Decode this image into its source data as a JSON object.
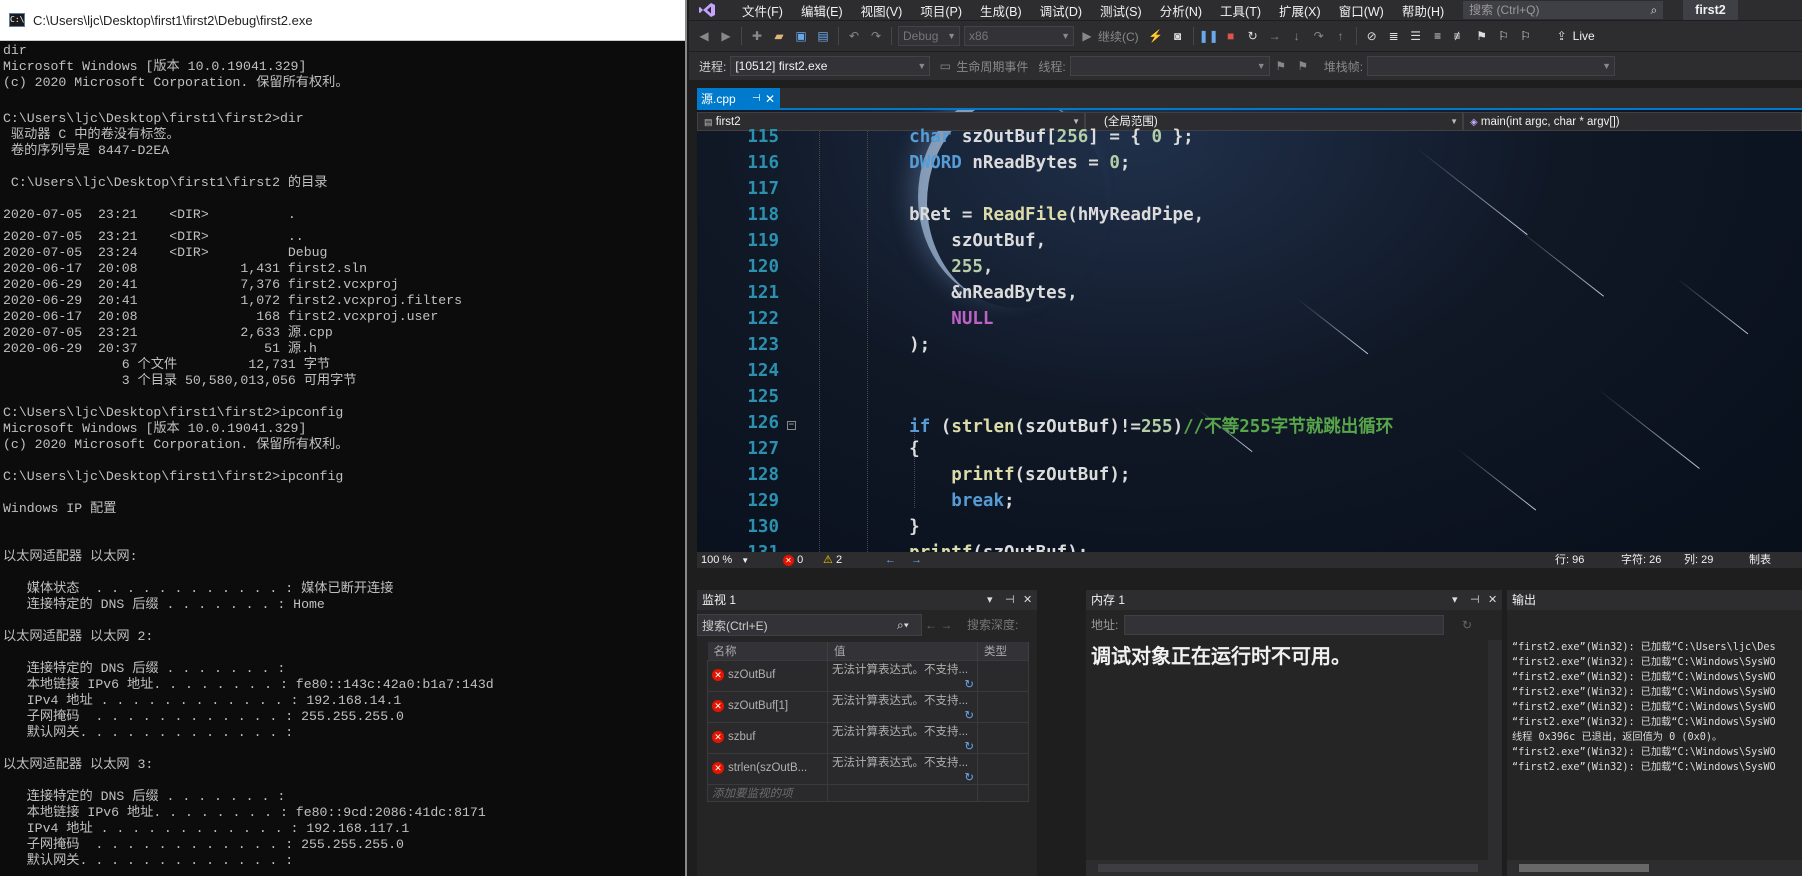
{
  "cmd": {
    "title": "C:\\Users\\ljc\\Desktop\\first1\\first2\\Debug\\first2.exe",
    "icon_text": "C:\\",
    "lines": [
      "dir",
      "Microsoft Windows [版本 10.0.19041.329]",
      "(c) 2020 Microsoft Corporation. 保留所有权利。",
      "",
      "C:\\Users\\ljc\\Desktop\\first1\\first2>dir",
      " 驱动器 C 中的卷没有标签。",
      " 卷的序列号是 8447-D2EA",
      "",
      " C:\\Users\\ljc\\Desktop\\first1\\first2 的目录",
      "",
      "2020-07-05  23:21    <DIR>          .",
      "2020-07-05  23:21    <DIR>          ..",
      "2020-07-05  23:24    <DIR>          Debug",
      "2020-06-17  20:08             1,431 first2.sln",
      "2020-06-29  20:41             7,376 first2.vcxproj",
      "2020-06-29  20:41             1,072 first2.vcxproj.filters",
      "2020-06-17  20:08               168 first2.vcxproj.user",
      "2020-07-05  23:21             2,633 源.cpp",
      "2020-06-29  20:37                51 源.h",
      "               6 个文件         12,731 字节",
      "               3 个目录 50,580,013,056 可用字节",
      "",
      "C:\\Users\\ljc\\Desktop\\first1\\first2>ipconfig",
      "Microsoft Windows [版本 10.0.19041.329]",
      "(c) 2020 Microsoft Corporation. 保留所有权利。",
      "",
      "C:\\Users\\ljc\\Desktop\\first1\\first2>ipconfig",
      "",
      "Windows IP 配置",
      "",
      "",
      "以太网适配器 以太网:",
      "",
      "   媒体状态  . . . . . . . . . . . . : 媒体已断开连接",
      "   连接特定的 DNS 后缀 . . . . . . . : Home",
      "",
      "以太网适配器 以太网 2:",
      "",
      "   连接特定的 DNS 后缀 . . . . . . . :",
      "   本地链接 IPv6 地址. . . . . . . . : fe80::143c:42a0:b1a7:143d",
      "   IPv4 地址 . . . . . . . . . . . . : 192.168.14.1",
      "   子网掩码  . . . . . . . . . . . . : 255.255.255.0",
      "   默认网关. . . . . . . . . . . . . :",
      "",
      "以太网适配器 以太网 3:",
      "",
      "   连接特定的 DNS 后缀 . . . . . . . :",
      "   本地链接 IPv6 地址. . . . . . . . : fe80::9cd:2086:41dc:8171",
      "   IPv4 地址 . . . . . . . . . . . . : 192.168.117.1",
      "   子网掩码  . . . . . . . . . . . . : 255.255.255.0",
      "   默认网关. . . . . . . . . . . . . :"
    ]
  },
  "vs": {
    "menu": [
      "文件(F)",
      "编辑(E)",
      "视图(V)",
      "项目(P)",
      "生成(B)",
      "调试(D)",
      "测试(S)",
      "分析(N)",
      "工具(T)",
      "扩展(X)",
      "窗口(W)",
      "帮助(H)"
    ],
    "search_placeholder": "搜索 (Ctrl+Q)",
    "project_name": "first2",
    "toolbar": {
      "config": "Debug",
      "platform": "x86",
      "continue": "继续(C)",
      "live": "Live"
    },
    "debugbar": {
      "process_label": "进程:",
      "process_value": "[10512] first2.exe",
      "lifecycle_label": "生命周期事件",
      "thread_label": "线程:",
      "stack_label": "堆栈帧:"
    },
    "tab": {
      "label": "源.cpp",
      "pin": "⊣",
      "close": "✕"
    },
    "nav": {
      "project": "first2",
      "scope": "(全局范围)",
      "function": "main(int argc, char * argv[])"
    },
    "code": [
      {
        "n": "115",
        "html": "    <span class='kw'>char</span> szOutBuf[<span class='num'>256</span>] = { <span class='num'>0</span> };"
      },
      {
        "n": "116",
        "html": "    <span class='ty'>DWORD</span> nReadBytes = <span class='num'>0</span>;"
      },
      {
        "n": "117",
        "html": ""
      },
      {
        "n": "118",
        "html": "    bRet = <span class='fn'>ReadFile</span>(hMyReadPipe,"
      },
      {
        "n": "119",
        "html": "        szOutBuf,"
      },
      {
        "n": "120",
        "html": "        <span class='num'>255</span>,"
      },
      {
        "n": "121",
        "html": "        &amp;nReadBytes,"
      },
      {
        "n": "122",
        "html": "        <span class='mc'>NULL</span>"
      },
      {
        "n": "123",
        "html": "    );"
      },
      {
        "n": "124",
        "html": ""
      },
      {
        "n": "125",
        "html": ""
      },
      {
        "n": "126",
        "html": "    <span class='kw'>if</span> (<span class='fn'>strlen</span>(szOutBuf)!=<span class='num'>255</span>)<span class='cm'>//不等255字节就跳出循环</span>"
      },
      {
        "n": "127",
        "html": "    {"
      },
      {
        "n": "128",
        "html": "        <span class='fn'>printf</span>(szOutBuf);"
      },
      {
        "n": "129",
        "html": "        <span class='kw'>break</span>;"
      },
      {
        "n": "130",
        "html": "    }"
      },
      {
        "n": "131",
        "html": "    <span class='fn'>printf</span>(szOutBuf);"
      }
    ],
    "status": {
      "zoom": "100 %",
      "errors": "0",
      "warnings": "2",
      "row": "行: 96",
      "char": "字符: 26",
      "col": "列: 29",
      "tab": "制表"
    },
    "watch": {
      "title": "监视 1",
      "search_placeholder": "搜索(Ctrl+E)",
      "depth_label": "搜索深度:",
      "headers": [
        "名称",
        "值",
        "类型"
      ],
      "rows": [
        {
          "name": "szOutBuf",
          "value": "无法计算表达式。不支持..."
        },
        {
          "name": "szOutBuf[1]",
          "value": "无法计算表达式。不支持..."
        },
        {
          "name": "szbuf",
          "value": "无法计算表达式。不支持..."
        },
        {
          "name": "strlen(szOutB...",
          "value": "无法计算表达式。不支持..."
        }
      ],
      "add_hint": "添加要监视的项"
    },
    "memory": {
      "title": "内存 1",
      "address_label": "地址:",
      "message": "调试对象正在运行时不可用。"
    },
    "output": {
      "title": "输出",
      "lines": [
        "“first2.exe”(Win32): 已加载“C:\\Users\\ljc\\Des",
        "“first2.exe”(Win32): 已加载“C:\\Windows\\SysWO",
        "“first2.exe”(Win32): 已加载“C:\\Windows\\SysWO",
        "“first2.exe”(Win32): 已加载“C:\\Windows\\SysWO",
        "“first2.exe”(Win32): 已加载“C:\\Windows\\SysWO",
        "“first2.exe”(Win32): 已加载“C:\\Windows\\SysWO",
        "线程 0x396c 已退出，返回值为 0 (0x0)。",
        "“first2.exe”(Win32): 已加载“C:\\Windows\\SysWO",
        "“first2.exe”(Win32): 已加载“C:\\Windows\\SysWO"
      ]
    }
  }
}
